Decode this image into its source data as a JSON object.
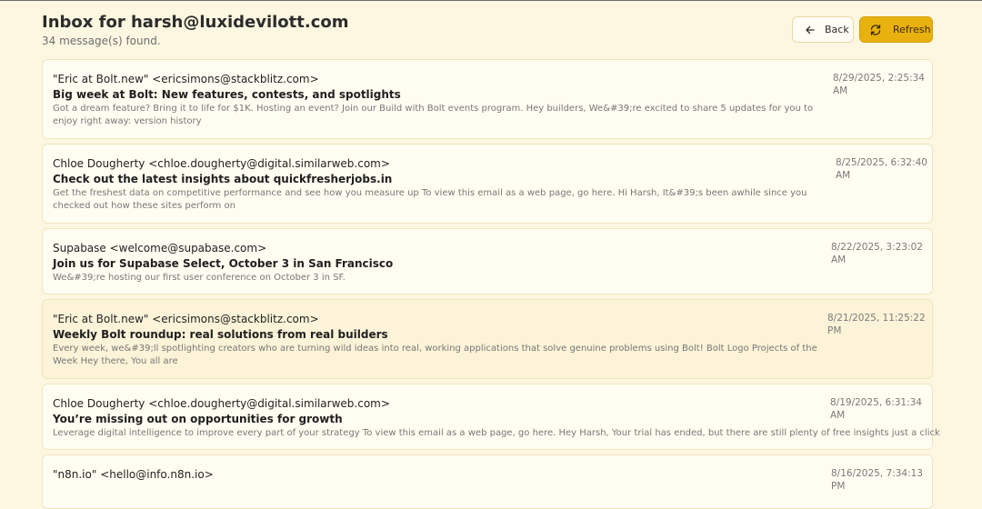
{
  "header": {
    "title": "Inbox for harsh@luxidevilott.com",
    "count_text": "34 message(s) found.",
    "back_label": "Back",
    "refresh_label": "Refresh"
  },
  "colors": {
    "accent": "#e9b10e",
    "background": "#fdf7e1",
    "card": "#fffdf1",
    "card_highlight": "#fcf3d8"
  },
  "emails": [
    {
      "from": "\"Eric at Bolt.new\" <ericsimons@stackblitz.com>",
      "subject": "Big week at Bolt: New features, contests, and spotlights",
      "snippet": "Got a dream feature? Bring it to life for $1K. Hosting an event? Join our Build with Bolt events program. Hey builders, We&#39;re excited to share 5 updates for you to enjoy right away: version history",
      "date_line1": "8/29/2025, 2:25:34",
      "date_line2": "AM"
    },
    {
      "from": "Chloe Dougherty <chloe.dougherty@digital.similarweb.com>",
      "subject": "Check out the latest insights about quickfresherjobs.in",
      "snippet": "Get the freshest data on competitive performance and see how you measure up To view this email as a web page, go here. Hi Harsh, It&#39;s been awhile since you checked out how these sites perform on",
      "date_line1": "8/25/2025, 6:32:40",
      "date_line2": "AM"
    },
    {
      "from": "Supabase <welcome@supabase.com>",
      "subject": "Join us for Supabase Select, October 3 in San Francisco",
      "snippet": "We&#39;re hosting our first user conference on October 3 in SF.",
      "date_line1": "8/22/2025, 3:23:02 AM",
      "date_line2": ""
    },
    {
      "from": "\"Eric at Bolt.new\" <ericsimons@stackblitz.com>",
      "subject": "Weekly Bolt roundup: real solutions from real builders",
      "snippet": "Every week, we&#39;ll spotlighting creators who are turning wild ideas into real, working applications that solve genuine problems using Bolt! Bolt Logo Projects of the Week Hey there, You all are",
      "date_line1": "8/21/2025, 11:25:22",
      "date_line2": "PM"
    },
    {
      "from": "Chloe Dougherty <chloe.dougherty@digital.similarweb.com>",
      "subject": "You’re missing out on opportunities for growth",
      "snippet": "Leverage digital intelligence to improve every part of your strategy To view this email as a web page, go here. Hey Harsh, Your trial has ended, but there are still plenty of free insights just a click",
      "date_line1": "8/19/2025, 6:31:34 AM",
      "date_line2": ""
    },
    {
      "from": "\"n8n.io\" <hello@info.n8n.io>",
      "subject": "",
      "snippet": "",
      "date_line1": "8/16/2025, 7:34:13 PM",
      "date_line2": ""
    }
  ]
}
